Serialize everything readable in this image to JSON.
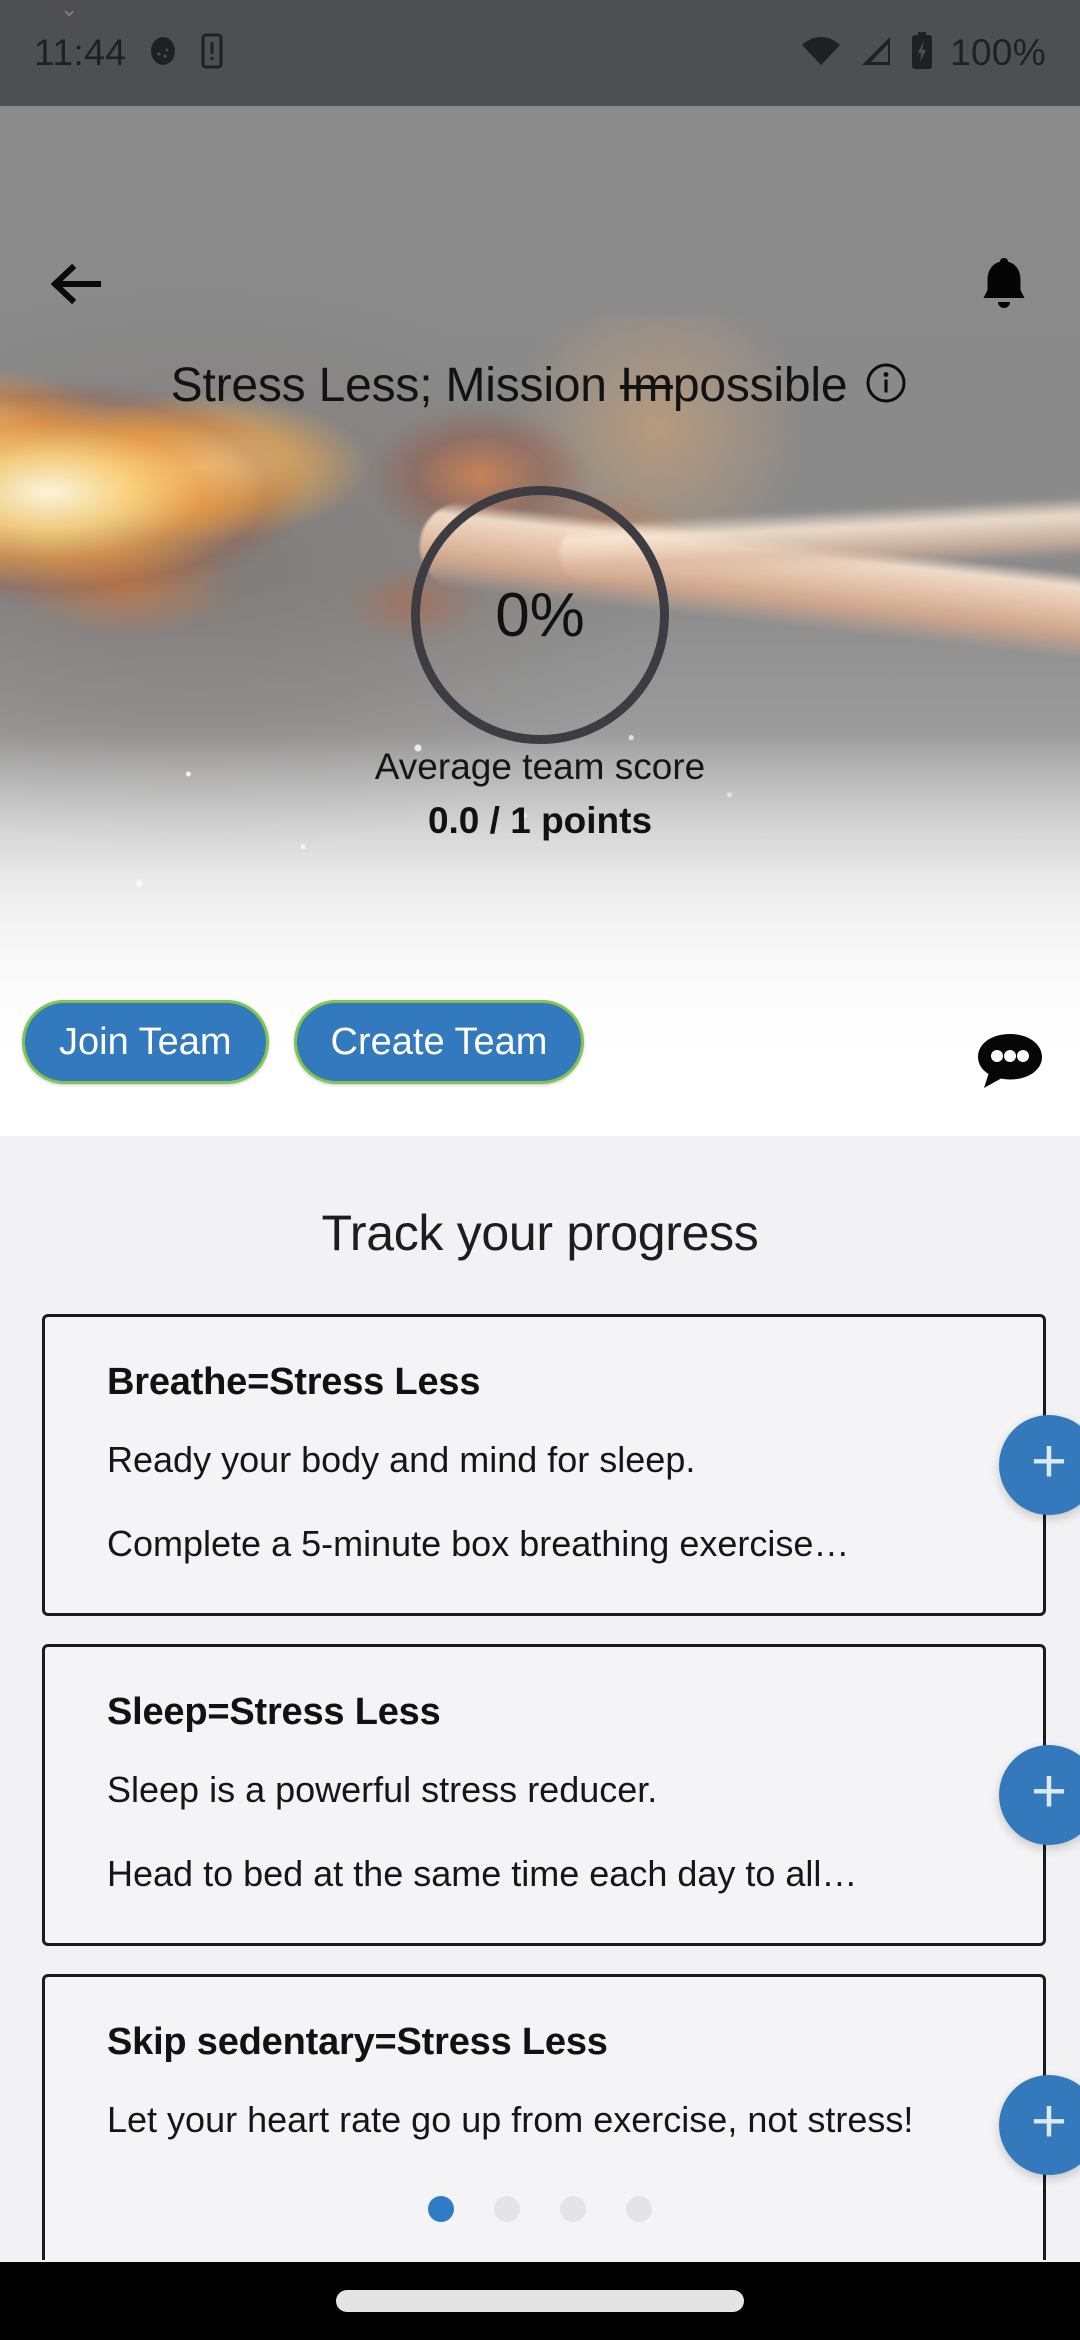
{
  "status_bar": {
    "time": "11:44",
    "battery_text": "100%",
    "icons": [
      "screenshot-icon",
      "vibrate-icon",
      "wifi-icon",
      "cellular-signal-icon",
      "battery-charging-icon"
    ],
    "background_color": "#4e4f53"
  },
  "header": {
    "back_icon": "back-arrow-icon",
    "notification_icon": "bell-icon",
    "title_prefix": "Stress Less; Mission ",
    "title_struck": "Im",
    "title_suffix": "possible",
    "info_icon": "info-circle-icon"
  },
  "hero": {
    "progress_percent": "0%",
    "average_label": "Average team score",
    "points_label": "0.0 / 1 points",
    "ring_color": "#3c3c42"
  },
  "actions": {
    "join_team": "Join Team",
    "create_team": "Create Team",
    "chat_icon": "chat-bubble-icon",
    "button_fill": "#3279bd",
    "button_border": "#82c44c"
  },
  "progress_section": {
    "title": "Track your progress",
    "cards": [
      {
        "title": "Breathe=Stress Less",
        "subtitle": "Ready your body and mind for sleep.",
        "detail": "Complete a 5-minute box breathing exercise…",
        "add_icon": "plus-icon"
      },
      {
        "title": "Sleep=Stress Less",
        "subtitle": "Sleep is a powerful stress reducer.",
        "detail": "Head to bed at the same time each day to all…",
        "add_icon": "plus-icon"
      },
      {
        "title": "Skip sedentary=Stress Less",
        "subtitle": "Let your heart rate go up from exercise, not stress!",
        "detail": "",
        "add_icon": "plus-icon"
      }
    ],
    "pagination": {
      "total": 4,
      "active_index": 0,
      "active_color": "#2f7bc4",
      "inactive_color": "#e4e4e8"
    }
  },
  "nav_bar": {
    "home_indicator": "home-gesture-indicator"
  }
}
